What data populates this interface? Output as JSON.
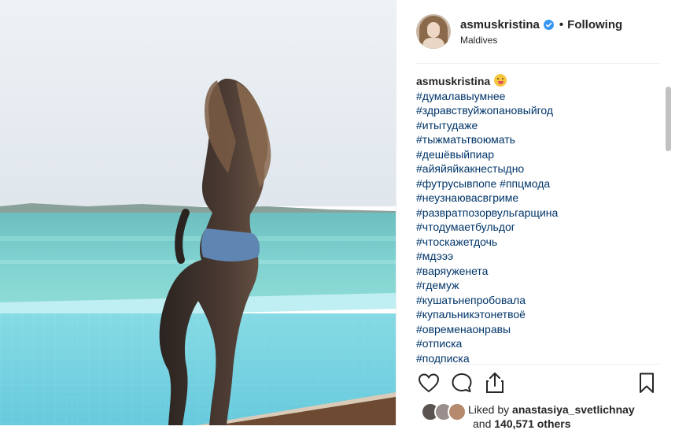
{
  "post": {
    "photo_alt": "",
    "author": {
      "username": "asmuskristina",
      "verified": true,
      "separator": "•",
      "follow_state": "Following",
      "location": "Maldives"
    },
    "caption": {
      "author": "asmuskristina",
      "emoji": "squinting-face-with-tongue",
      "hashtags": [
        "#думалавыумнее",
        "#здравствуйжопановыйгод",
        "#итытудаже",
        "#тыжматьтвоюмать",
        "#дешёвыйпиар",
        "#айяйяйкакнестыдно",
        "#футрусывпопе #ппцмода",
        "#неузнаювасвгриме",
        "#развратпозорвульгарщина",
        "#чтодумаетбульдог",
        "#чтоскажетдочь",
        "#мдэээ",
        "#варяуженета",
        "#гдемуж",
        "#кушатьнепробовала",
        "#купальникэтонетвоё",
        "#овременаонравы",
        "#отписка",
        "#подписка"
      ]
    },
    "actions": {
      "like": "heart-outline-icon",
      "comment": "comment-bubble-icon",
      "share": "share-upload-icon",
      "save": "bookmark-icon"
    },
    "likes": {
      "prefix": "Liked by",
      "liked_by": "anastasiya_svetlichnay",
      "and": "and",
      "others_count": "140,571 others"
    },
    "colors": {
      "link": "#003569",
      "text": "#262626",
      "verified": "#3897f0",
      "divider": "#efefef"
    }
  }
}
